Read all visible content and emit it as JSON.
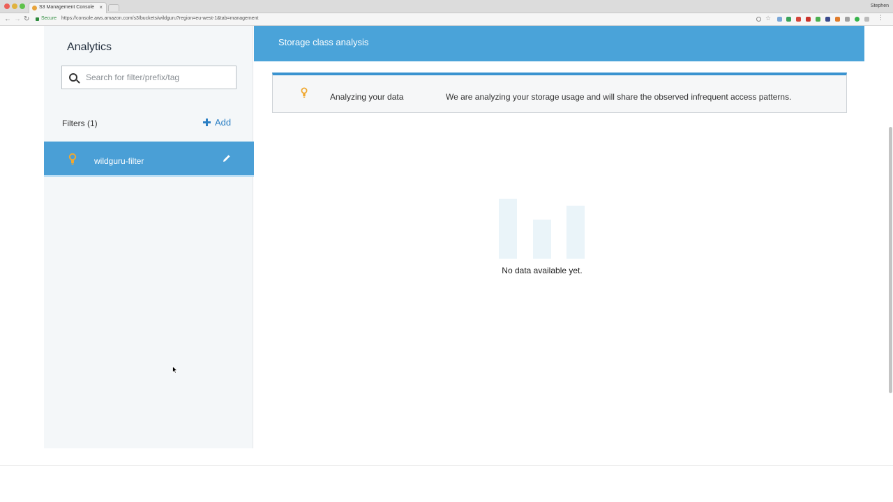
{
  "browser": {
    "tab_title": "S3 Management Console",
    "tab_close": "×",
    "profile_name": "Stephen",
    "secure_label": "Secure",
    "url": "https://console.aws.amazon.com/s3/buckets/wildguru?region=eu-west-1&tab=management",
    "nav": {
      "back": "←",
      "forward": "→",
      "reload": "↻"
    }
  },
  "sidebar": {
    "title": "Analytics",
    "search_placeholder": "Search for filter/prefix/tag",
    "filters_label": "Filters (1)",
    "add_label": "Add",
    "filters": [
      {
        "name": "wildguru-filter",
        "selected": true
      }
    ]
  },
  "main": {
    "header_title": "Storage class analysis",
    "info": {
      "title": "Analyzing your data",
      "message": "We are analyzing your storage usage and will share the observed infrequent access patterns."
    },
    "empty_state": {
      "message": "No data available yet."
    }
  },
  "colors": {
    "accent": "#4aa3d9",
    "selected_row": "#4a9fd6",
    "bulb": "#f0a830",
    "link": "#2b7fc4"
  }
}
